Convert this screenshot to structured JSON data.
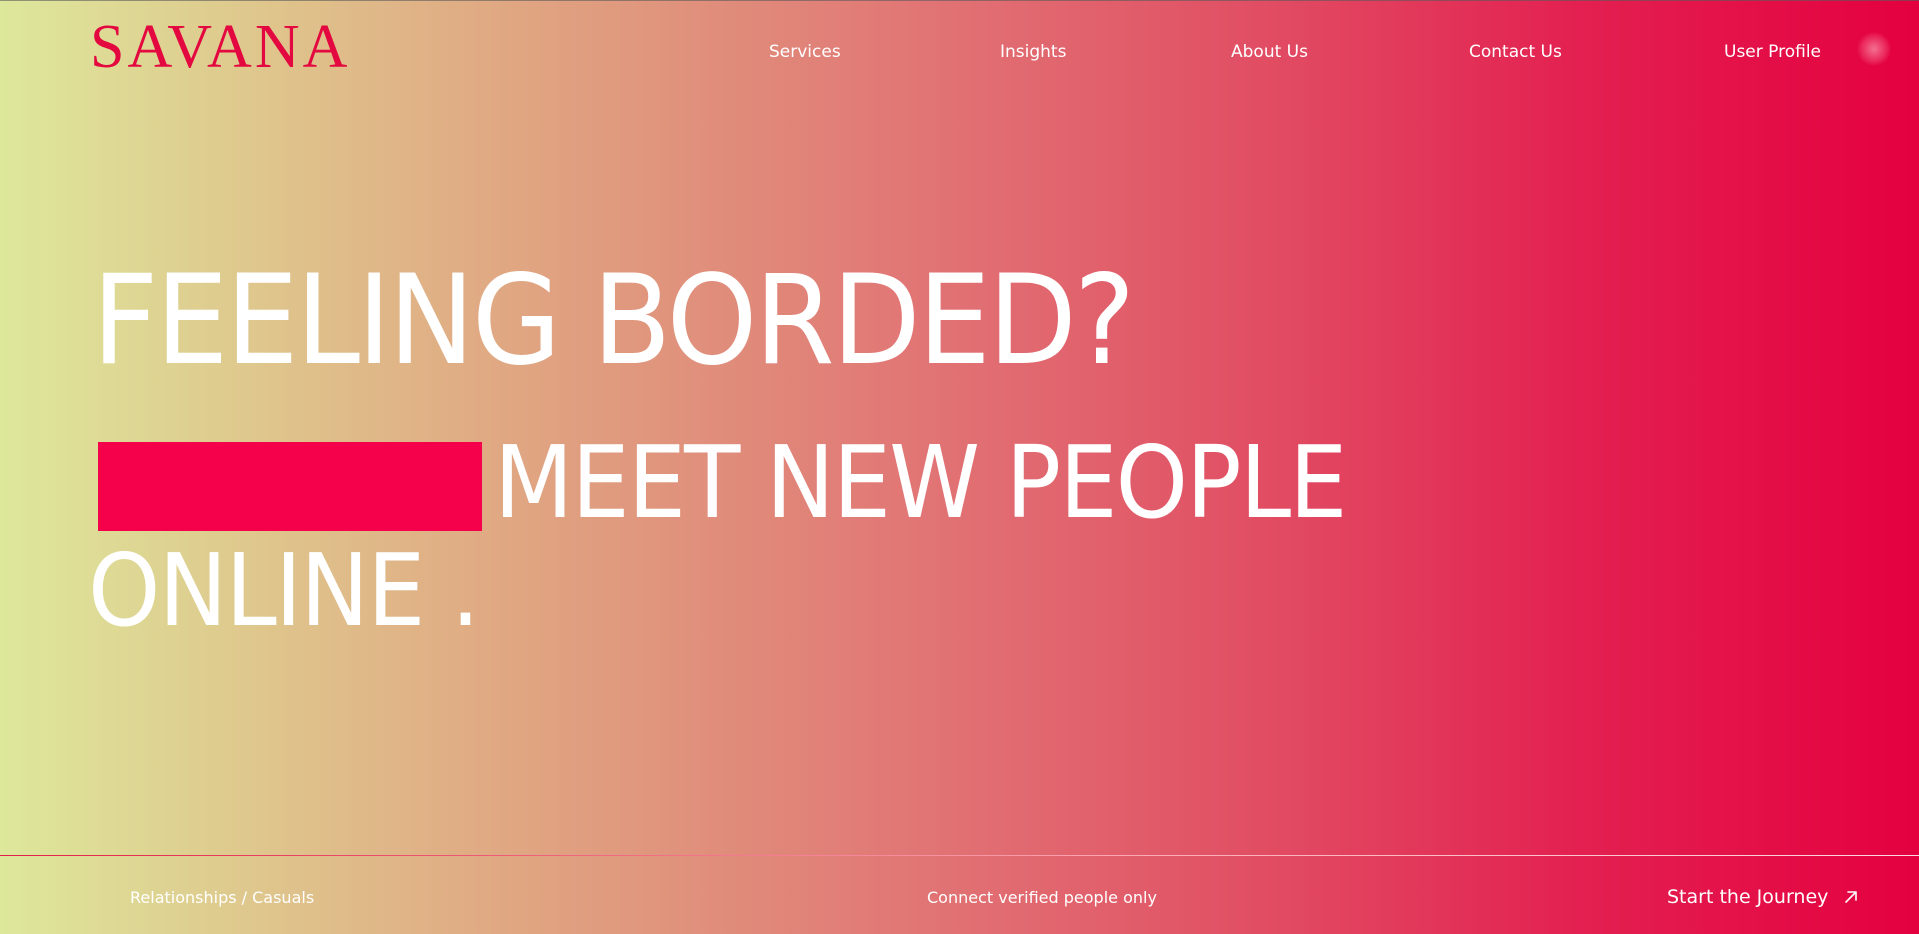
{
  "brand": {
    "logo_text": "SAVANA",
    "accent_color": "#e3083f",
    "highlight_color": "#f5004b"
  },
  "nav": {
    "items": [
      {
        "label": "Services"
      },
      {
        "label": "Insights"
      },
      {
        "label": "About Us"
      },
      {
        "label": "Contact Us"
      },
      {
        "label": "User Profile"
      }
    ],
    "avatar_icon": "avatar"
  },
  "hero": {
    "headline": "FEELING BORDED?",
    "subline_1": "MEET NEW PEOPLE",
    "subline_2": "ONLINE ."
  },
  "footer": {
    "left_text": "Relationships / Casuals",
    "center_text": "Connect verified people only",
    "cta_label": "Start the Journey",
    "cta_icon": "arrow-up-right-icon"
  }
}
